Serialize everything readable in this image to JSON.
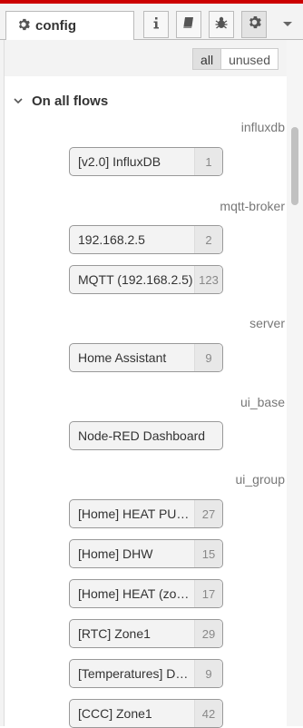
{
  "tabs": {
    "active_label": "config",
    "active_icon": "gear-icon",
    "buttons": [
      {
        "name": "info-icon",
        "selected": false
      },
      {
        "name": "book-icon",
        "selected": false
      },
      {
        "name": "bug-icon",
        "selected": false
      },
      {
        "name": "gear-icon",
        "selected": true
      }
    ],
    "menu_icon": "chevron-down-icon"
  },
  "filter": {
    "all": "all",
    "unused": "unused"
  },
  "section": {
    "title": "On all flows"
  },
  "groups": [
    {
      "type": "influxdb",
      "nodes": [
        {
          "label": "[v2.0] InfluxDB",
          "count": "1"
        }
      ]
    },
    {
      "type": "mqtt-broker",
      "nodes": [
        {
          "label": "192.168.2.5",
          "count": "2"
        },
        {
          "label": "MQTT (192.168.2.5)",
          "count": "123"
        }
      ]
    },
    {
      "type": "server",
      "nodes": [
        {
          "label": "Home Assistant",
          "count": "9"
        }
      ]
    },
    {
      "type": "ui_base",
      "nodes": [
        {
          "label": "Node-RED Dashboard",
          "count": ""
        }
      ]
    },
    {
      "type": "ui_group",
      "nodes": [
        {
          "label": "[Home] HEAT PUMP",
          "count": "27"
        },
        {
          "label": "[Home] DHW",
          "count": "15"
        },
        {
          "label": "[Home] HEAT (zon…",
          "count": "17"
        },
        {
          "label": "[RTC] Zone1",
          "count": "29"
        },
        {
          "label": "[Temperatures] D…",
          "count": "9"
        },
        {
          "label": "[CCC] Zone1",
          "count": "42"
        }
      ]
    }
  ],
  "colors": {
    "accent_top": "#cc0000"
  }
}
